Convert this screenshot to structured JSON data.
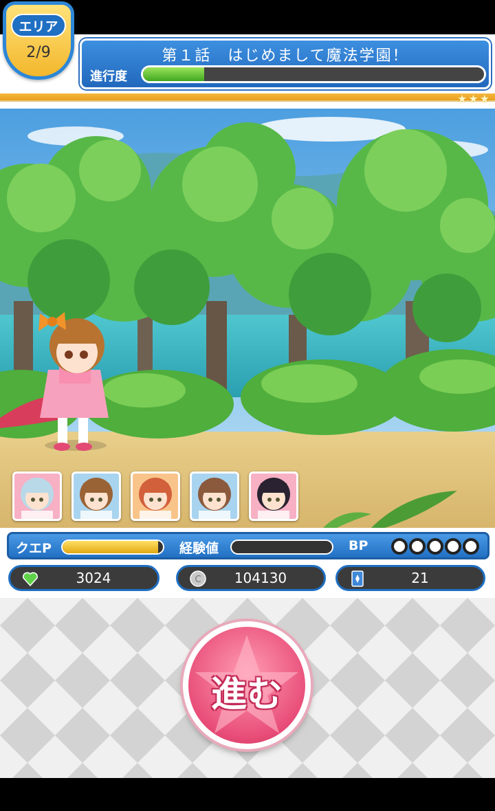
{
  "area": {
    "label": "エリア",
    "value": "2/9"
  },
  "chapter": {
    "title": "第１話　はじめまして魔法学園！",
    "progress_label": "進行度",
    "progress": 0.18
  },
  "stars_count": 3,
  "party": [
    {
      "name": "party-member-1",
      "hair": "#b9d9e8"
    },
    {
      "name": "party-member-2",
      "hair": "#9a6335"
    },
    {
      "name": "party-member-3",
      "hair": "#d2603a"
    },
    {
      "name": "party-member-4",
      "hair": "#8b5a3c"
    },
    {
      "name": "party-member-5",
      "hair": "#2a2230"
    }
  ],
  "stats": {
    "quest_label": "クエP",
    "quest_fill": 0.95,
    "exp_label": "経験値",
    "exp_fill": 0.0,
    "bp_label": "BP",
    "bp_count": 5
  },
  "counters": {
    "hearts": "3024",
    "coins": "104130",
    "cards": "21"
  },
  "advance": {
    "label": "進む"
  },
  "colors": {
    "accent_blue": "#2a78cc",
    "gold": "#f3b72c",
    "button_pink": "#e84d78",
    "progress_green": "#4db32a"
  }
}
